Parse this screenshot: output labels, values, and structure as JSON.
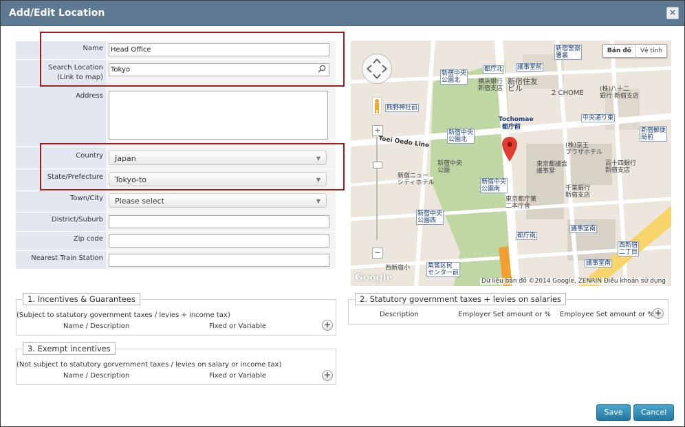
{
  "dialog": {
    "title": "Add/Edit Location",
    "close_label": "×"
  },
  "form": {
    "name": {
      "label": "Name",
      "value": "Head Office"
    },
    "search": {
      "label": "Search Location",
      "sublabel": "(Link to map)",
      "value": "Tokyo"
    },
    "address": {
      "label": "Address",
      "value": ""
    },
    "country": {
      "label": "Country",
      "value": "Japan"
    },
    "state": {
      "label": "State/Prefecture",
      "value": "Tokyo-to"
    },
    "town": {
      "label": "Town/City",
      "value": "Please select"
    },
    "district": {
      "label": "District/Suburb",
      "value": ""
    },
    "zip": {
      "label": "Zip code",
      "value": ""
    },
    "station": {
      "label": "Nearest Train Station",
      "value": ""
    }
  },
  "map": {
    "type_map": "Bản đồ",
    "type_satellite": "Vệ tinh",
    "attribution": "Dữ liệu bản đồ ©2014 Google, ZENRIN   Điều khoản sử dụng",
    "logo": "Google",
    "labels": {
      "tochomae": "Tochomae",
      "tochomae_jp": "都庁前",
      "toei_oedo": "Toei Oedo Line",
      "shinjuku_chuo_park_n": "新宿中央\n公園北",
      "shinjuku_chuo_park": "新宿中央\n公園",
      "kumano": "熊野神社前",
      "tochokita": "都庁北",
      "gijido": "議事堂前",
      "nishishinjuku": "西新宿\n二丁目",
      "east": "東京",
      "park_west": "新宿中央\n公園西",
      "park_south": "新宿中央\n公園南",
      "tocho_minami": "都庁南",
      "gijido_minami": "議事堂南",
      "chome2": "2 CHOME",
      "chuodori": "中央通り東",
      "plaza": "京王\nプラザホテル",
      "tokyo_gijido": "東京都議会\n議事堂",
      "kakudo": "角筈区民\nセンター前",
      "nishi": "西新宿小",
      "hotel": "新宿ニュー\nシティホテル",
      "seiyaku": "新宿警察\n署裏",
      "bank": "横浜銀行\n新宿支店",
      "sumitomo": "新宿住友\nビル",
      "hachi": "(株)八十二\n銀行 新宿支店",
      "hyakujushi": "百十四銀行\n新宿支店",
      "chiba": "千葉銀行\n新宿支店",
      "tochodai2": "東京都庁第\n二本庁舎",
      "keio": "(株)京王\nプラザホテル",
      "post": "新宿郵便\n局前",
      "gijidominami2": "議事堂南"
    }
  },
  "incentives": {
    "title": "1. Incentives & Guarantees",
    "note": "(Subject to statutory government taxes / levies + income tax)",
    "col1": "Name / Description",
    "col2": "Fixed or Variable"
  },
  "exempt": {
    "title": "3. Exempt incentives",
    "note": "(Not subject to statutory gorvernment taxes / levies on salary or income tax)",
    "col1": "Name / Description",
    "col2": "Fixed or Variable"
  },
  "statutory": {
    "title": "2. Statutory government taxes + levies on salaries",
    "col1": "Description",
    "col2": "Employer Set amount or %",
    "col3": "Employee Set amount or %"
  },
  "buttons": {
    "save": "Save",
    "cancel": "Cancel"
  },
  "colors": {
    "titlebar": "#5e7a92",
    "button": "#2d86b3",
    "highlight": "#a61b1b"
  }
}
